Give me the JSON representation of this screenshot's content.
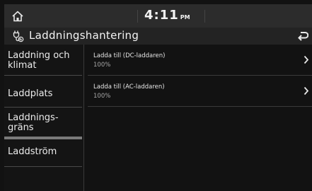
{
  "statusbar": {
    "time": "4:11",
    "ampm": "PM"
  },
  "titlebar": {
    "title": "Laddningshantering",
    "icons": [
      "ev-charging-icon",
      "back-icon"
    ]
  },
  "sidebar": {
    "items": [
      {
        "label": "Laddning och\nklimat"
      },
      {
        "label": "Laddplats"
      },
      {
        "label": "Laddnings-\ngräns",
        "selected": true
      },
      {
        "label": "Laddström"
      }
    ]
  },
  "main": {
    "rows": [
      {
        "title": "Ladda till (DC-laddaren)",
        "value": "100%"
      },
      {
        "title": "Ladda till (AC-laddaren)",
        "value": "100%"
      }
    ]
  }
}
